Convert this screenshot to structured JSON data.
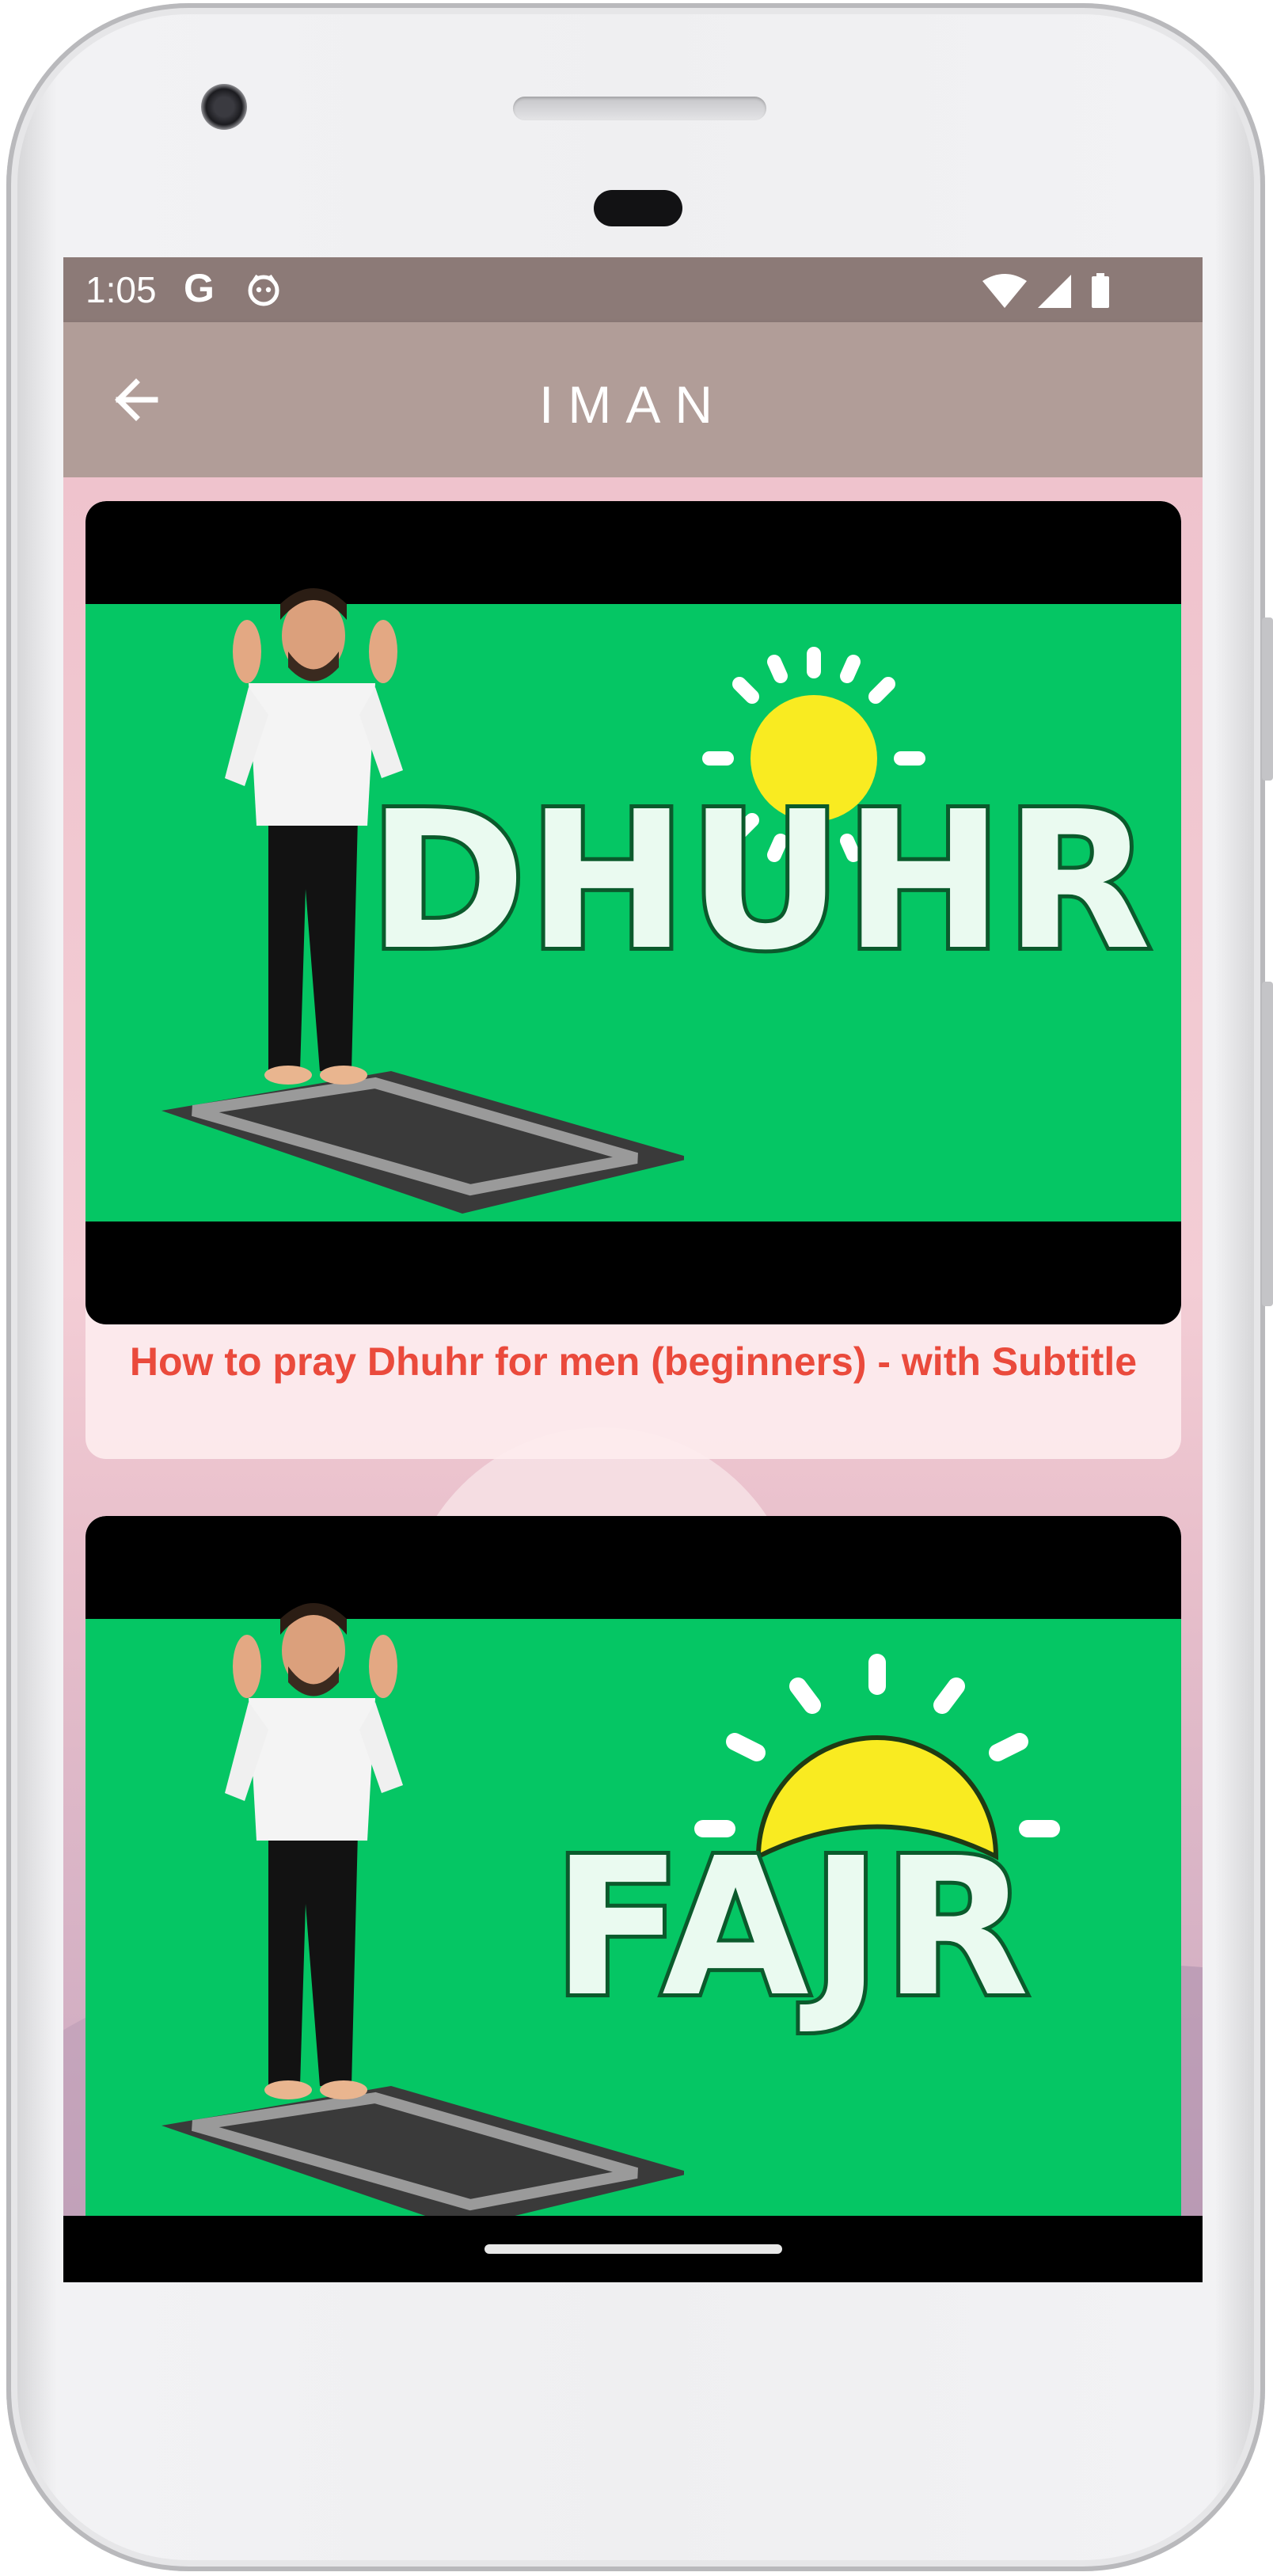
{
  "status_bar": {
    "time": "1:05",
    "g_icon": "G"
  },
  "app_bar": {
    "title": "IMAN",
    "back_icon": "arrow-left-icon"
  },
  "videos": [
    {
      "thumbnail_text": "DHUHR",
      "title": "How to pray Dhuhr for men (beginners) - with Subtitle",
      "sun": "full-sun-icon"
    },
    {
      "thumbnail_text": "FAJR",
      "sun": "rising-sun-icon"
    }
  ],
  "colors": {
    "status_bar": "#8c7a77",
    "app_bar": "#b19d98",
    "thumbnail_green": "#05c664",
    "title_red": "#ea4a3c",
    "sun_yellow": "#f9eb21"
  }
}
